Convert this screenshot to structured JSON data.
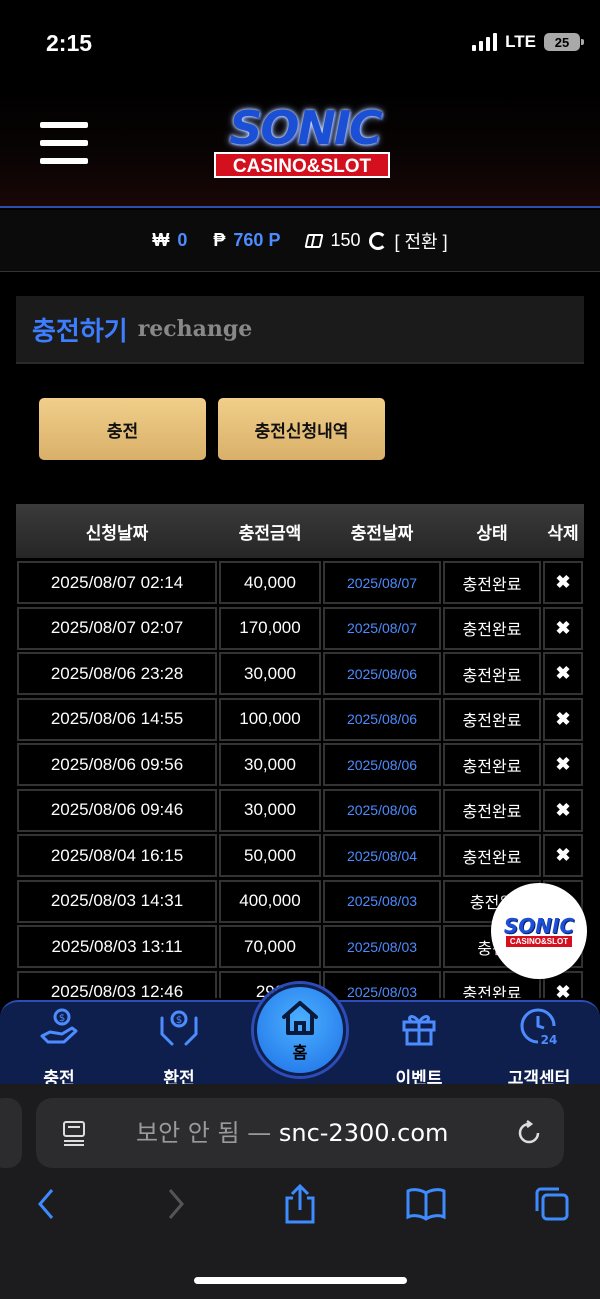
{
  "status_bar": {
    "time": "2:15",
    "network": "LTE",
    "battery": "25"
  },
  "header": {
    "logo_main": "SONIC",
    "logo_sub": "CASINO&SLOT"
  },
  "balance": {
    "won_symbol": "₩",
    "won_value": "0",
    "point_symbol": "₱",
    "point_value": "760 P",
    "chips_value": "150",
    "switch_label": "[ 전환 ]"
  },
  "section": {
    "title_ko": "충전하기",
    "title_en": "rechange"
  },
  "buttons": {
    "charge": "충전",
    "history": "충전신청내역"
  },
  "table": {
    "headers": [
      "신청날짜",
      "충전금액",
      "충전날짜",
      "상태",
      "삭제"
    ],
    "rows": [
      {
        "request_date": "2025/08/07 02:14",
        "amount": "40,000",
        "charge_date": "2025/08/07",
        "status": "충전완료"
      },
      {
        "request_date": "2025/08/07 02:07",
        "amount": "170,000",
        "charge_date": "2025/08/07",
        "status": "충전완료"
      },
      {
        "request_date": "2025/08/06 23:28",
        "amount": "30,000",
        "charge_date": "2025/08/06",
        "status": "충전완료"
      },
      {
        "request_date": "2025/08/06 14:55",
        "amount": "100,000",
        "charge_date": "2025/08/06",
        "status": "충전완료"
      },
      {
        "request_date": "2025/08/06 09:56",
        "amount": "30,000",
        "charge_date": "2025/08/06",
        "status": "충전완료"
      },
      {
        "request_date": "2025/08/06 09:46",
        "amount": "30,000",
        "charge_date": "2025/08/06",
        "status": "충전완료"
      },
      {
        "request_date": "2025/08/04 16:15",
        "amount": "50,000",
        "charge_date": "2025/08/04",
        "status": "충전완료"
      },
      {
        "request_date": "2025/08/03 14:31",
        "amount": "400,000",
        "charge_date": "2025/08/03",
        "status": "충전완"
      },
      {
        "request_date": "2025/08/03 13:11",
        "amount": "70,000",
        "charge_date": "2025/08/03",
        "status": "충전"
      },
      {
        "request_date": "2025/08/03 12:46",
        "amount": "290",
        "charge_date": "2025/08/03",
        "status": "충전완료"
      }
    ],
    "delete_symbol": "✖"
  },
  "float_badge": {
    "main": "SONIC",
    "sub": "CASINO&SLOT"
  },
  "bottom_nav": {
    "charge": "충전",
    "exchange": "환전",
    "home": "홈",
    "event": "이벤트",
    "support": "고객센터"
  },
  "browser": {
    "insecure_label": "보안 안 됨",
    "separator": "—",
    "domain": "snc-2300.com"
  },
  "colors": {
    "accent_blue": "#3d7dff",
    "gold": "#e6c07a",
    "nav_bg": "#0f1f4d"
  }
}
